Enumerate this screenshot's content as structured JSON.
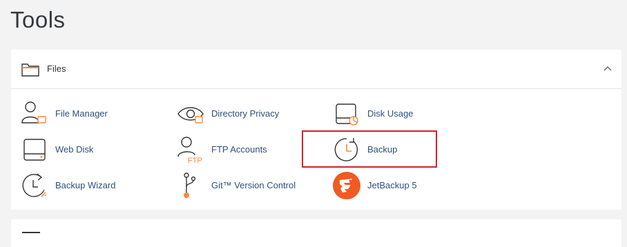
{
  "page": {
    "title": "Tools"
  },
  "section": {
    "title": "Files"
  },
  "tools": {
    "file_manager": "File Manager",
    "directory_privacy": "Directory Privacy",
    "disk_usage": "Disk Usage",
    "web_disk": "Web Disk",
    "ftp_accounts": "FTP Accounts",
    "backup": "Backup",
    "backup_wizard": "Backup Wizard",
    "git_version_control": "Git™ Version Control",
    "jetbackup": "JetBackup 5",
    "ftp_badge": "FTP"
  },
  "colors": {
    "accent": "#f58a3c",
    "link": "#2f4f7a",
    "highlight": "#d3212d",
    "jetbackup": "#f15a22"
  }
}
